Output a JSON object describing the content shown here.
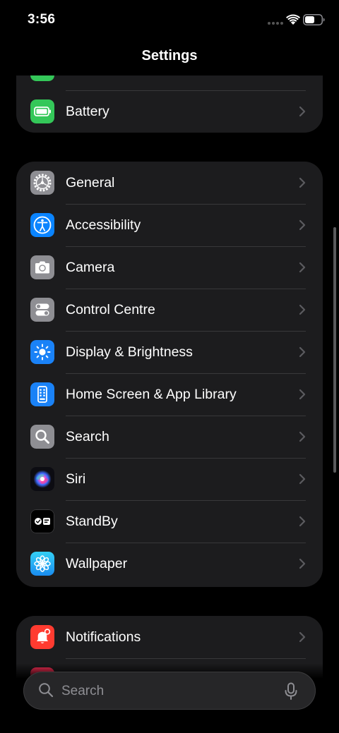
{
  "status_bar": {
    "time": "3:56"
  },
  "nav": {
    "title": "Settings"
  },
  "groups": [
    {
      "rows": [
        {
          "label": "Battery"
        }
      ]
    },
    {
      "rows": [
        {
          "label": "General"
        },
        {
          "label": "Accessibility"
        },
        {
          "label": "Camera"
        },
        {
          "label": "Control Centre"
        },
        {
          "label": "Display & Brightness"
        },
        {
          "label": "Home Screen & App Library"
        },
        {
          "label": "Search"
        },
        {
          "label": "Siri"
        },
        {
          "label": "StandBy"
        },
        {
          "label": "Wallpaper"
        }
      ]
    },
    {
      "rows": [
        {
          "label": "Notifications"
        }
      ]
    }
  ],
  "search": {
    "placeholder": "Search"
  },
  "colors": {
    "background": "#000000",
    "cell": "#1c1c1e",
    "separator": "#38383a",
    "chevron": "#5b5b5f",
    "placeholder": "#8e8e93",
    "battery_green": "#34c759",
    "accessibility_blue": "#0a84ff",
    "notifications_red": "#ff3b30"
  },
  "icons": {
    "battery_partial": "green-icon",
    "battery": "battery-icon",
    "general": "gear-icon",
    "accessibility": "accessibility-person-icon",
    "camera": "camera-icon",
    "control_centre": "toggles-icon",
    "display": "sun-icon",
    "home_screen": "phone-screen-icon",
    "search": "magnifier-icon",
    "siri": "siri-orb-icon",
    "standby": "standby-icon",
    "wallpaper": "flower-icon",
    "notifications": "bell-icon",
    "mic": "microphone-icon"
  }
}
